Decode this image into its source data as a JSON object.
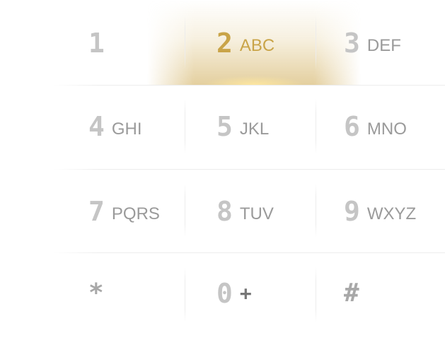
{
  "keypad": {
    "active_key": "2",
    "accent_color": "#c9a448",
    "keys": [
      {
        "digit": "1",
        "letters": ""
      },
      {
        "digit": "2",
        "letters": "ABC"
      },
      {
        "digit": "3",
        "letters": "DEF"
      },
      {
        "digit": "4",
        "letters": "GHI"
      },
      {
        "digit": "5",
        "letters": "JKL"
      },
      {
        "digit": "6",
        "letters": "MNO"
      },
      {
        "digit": "7",
        "letters": "PQRS"
      },
      {
        "digit": "8",
        "letters": "TUV"
      },
      {
        "digit": "9",
        "letters": "WXYZ"
      },
      {
        "digit": "*",
        "letters": ""
      },
      {
        "digit": "0",
        "letters": "+"
      },
      {
        "digit": "#",
        "letters": ""
      }
    ]
  }
}
